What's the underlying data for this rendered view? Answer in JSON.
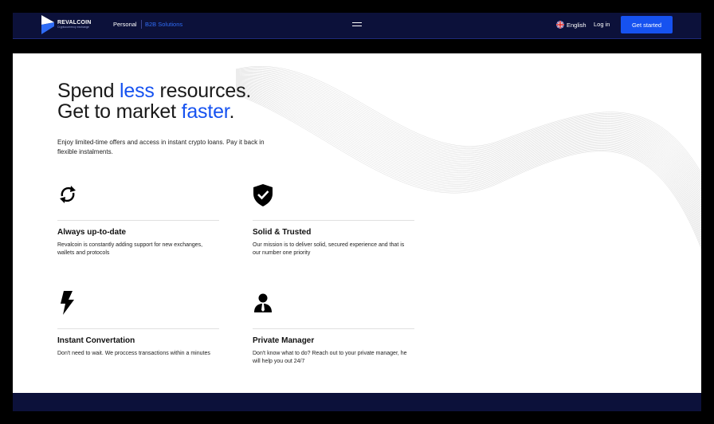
{
  "header": {
    "logo_name": "REVALCOIN",
    "logo_sub": "Cryptocurrency exchange",
    "nav_personal": "Personal",
    "nav_b2b": "B2B Solutions",
    "language": "English",
    "login": "Log in",
    "cta": "Get started"
  },
  "hero": {
    "line1_pre": "Spend ",
    "line1_accent": "less",
    "line1_post": " resources.",
    "line2_pre": "Get to market ",
    "line2_accent": "faster",
    "line2_post": ".",
    "description": "Enjoy limited-time offers and access in instant crypto loans. Pay it back in flexible instalments."
  },
  "features": [
    {
      "title": "Always up-to-date",
      "desc": "Revalcoin is constantly adding support for new exchanges, wallets and protocols",
      "icon": "refresh-icon"
    },
    {
      "title": "Solid & Trusted",
      "desc": "Our mission is to deliver solid, secured experience and that is our number one priority",
      "icon": "shield-check-icon"
    },
    {
      "title": "Instant Convertation",
      "desc": "Don't need to wait. We proccess transactions within a minutes",
      "icon": "lightning-icon"
    },
    {
      "title": "Private Manager",
      "desc": "Don't know what to do? Reach out to your private manager, he will help you out 24/7",
      "icon": "manager-icon"
    }
  ],
  "colors": {
    "accent": "#1652f0",
    "header_bg": "#0c113a"
  }
}
